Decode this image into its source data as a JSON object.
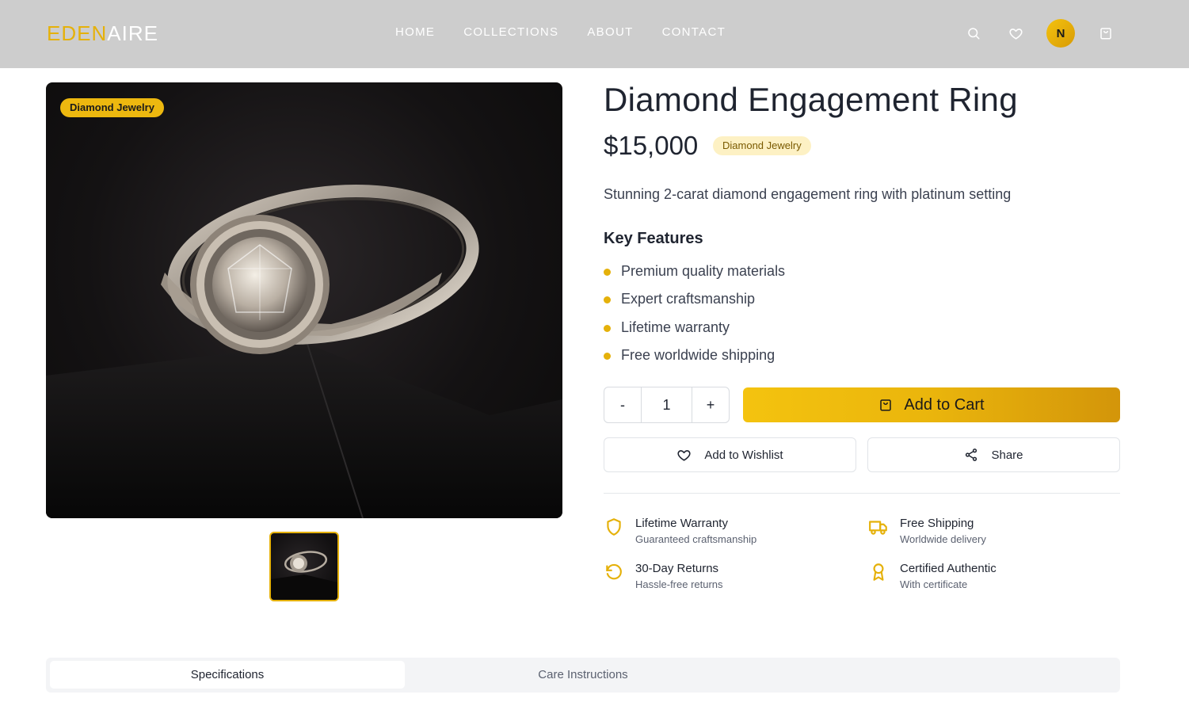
{
  "header": {
    "logo_part1": "EDEN",
    "logo_part2": "AIRE",
    "nav": [
      "HOME",
      "COLLECTIONS",
      "ABOUT",
      "CONTACT"
    ],
    "avatar_initial": "N",
    "icons": [
      "search-icon",
      "heart-icon",
      "shopping-bag-icon"
    ]
  },
  "product": {
    "image_badge": "Diamond Jewelry",
    "title": "Diamond Engagement Ring",
    "price": "$15,000",
    "category_badge": "Diamond Jewelry",
    "description": "Stunning 2-carat diamond engagement ring with platinum setting",
    "key_features_title": "Key Features",
    "features": [
      "Premium quality materials",
      "Expert craftsmanship",
      "Lifetime warranty",
      "Free worldwide shipping"
    ]
  },
  "purchase": {
    "minus_label": "-",
    "quantity": "1",
    "plus_label": "+",
    "add_to_cart_label": "Add to Cart",
    "wishlist_label": "Add to Wishlist",
    "share_label": "Share"
  },
  "perks": [
    {
      "title": "Lifetime Warranty",
      "subtitle": "Guaranteed craftsmanship",
      "icon": "shield-icon"
    },
    {
      "title": "Free Shipping",
      "subtitle": "Worldwide delivery",
      "icon": "truck-icon"
    },
    {
      "title": "30-Day Returns",
      "subtitle": "Hassle-free returns",
      "icon": "rotate-ccw-icon"
    },
    {
      "title": "Certified Authentic",
      "subtitle": "With certificate",
      "icon": "award-icon"
    }
  ],
  "tabs": [
    "Specifications",
    "Care Instructions"
  ],
  "colors": {
    "accent": "#e5b10a",
    "header_bg": "#cdcdcd"
  }
}
